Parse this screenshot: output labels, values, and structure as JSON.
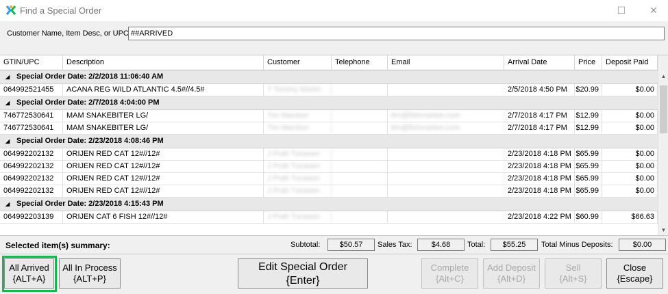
{
  "window": {
    "title": "Find a Special Order",
    "accent": "#1db44c"
  },
  "search": {
    "label": "Customer Name, Item Desc, or UPC:",
    "value": "##ARRIVED"
  },
  "columns": [
    "GTIN/UPC",
    "Description",
    "Customer",
    "Telephone",
    "Email",
    "Arrival Date",
    "Price",
    "Deposit Paid"
  ],
  "groups": [
    {
      "header": "Special Order Date: 2/2/2018 11:06:40 AM",
      "rows": [
        {
          "upc": "064992521455",
          "desc": "ACANA REG WILD ATLANTIC 4.5#//4.5#",
          "customer": "T Tommy Martin",
          "phone": "",
          "email": "",
          "arrival": "2/5/2018 4:50 PM",
          "price": "$20.99",
          "deposit": "$0.00"
        }
      ]
    },
    {
      "header": "Special Order Date: 2/7/2018 4:04:00 PM",
      "rows": [
        {
          "upc": "746772530641",
          "desc": "MAM SNAKEBITER LG/",
          "customer": "Tim Marston",
          "phone": "",
          "email": "tim@fishmarket.com",
          "arrival": "2/7/2018 4:17 PM",
          "price": "$12.99",
          "deposit": "$0.00"
        },
        {
          "upc": "746772530641",
          "desc": "MAM SNAKEBITER LG/",
          "customer": "Tim Marston",
          "phone": "",
          "email": "tim@fishmarket.com",
          "arrival": "2/7/2018 4:17 PM",
          "price": "$12.99",
          "deposit": "$0.00"
        }
      ]
    },
    {
      "header": "Special Order Date: 2/23/2018 4:08:46 PM",
      "rows": [
        {
          "upc": "064992202132",
          "desc": "ORIJEN RED CAT 12#//12#",
          "customer": "J Prah Tunasen",
          "phone": "",
          "email": "",
          "arrival": "2/23/2018 4:18 PM",
          "price": "$65.99",
          "deposit": "$0.00"
        },
        {
          "upc": "064992202132",
          "desc": "ORIJEN RED CAT 12#//12#",
          "customer": "J Prah Tunasen",
          "phone": "",
          "email": "",
          "arrival": "2/23/2018 4:18 PM",
          "price": "$65.99",
          "deposit": "$0.00"
        },
        {
          "upc": "064992202132",
          "desc": "ORIJEN RED CAT 12#//12#",
          "customer": "J Prah Tunasen",
          "phone": "",
          "email": "",
          "arrival": "2/23/2018 4:18 PM",
          "price": "$65.99",
          "deposit": "$0.00"
        },
        {
          "upc": "064992202132",
          "desc": "ORIJEN RED CAT 12#//12#",
          "customer": "J Prah Tunasen",
          "phone": "",
          "email": "",
          "arrival": "2/23/2018 4:18 PM",
          "price": "$65.99",
          "deposit": "$0.00"
        }
      ]
    },
    {
      "header": "Special Order Date: 2/23/2018 4:15:43 PM",
      "rows": [
        {
          "upc": "064992203139",
          "desc": "ORIJEN CAT 6 FISH 12#//12#",
          "customer": "J Prah Tunasen",
          "phone": "",
          "email": "",
          "arrival": "2/23/2018 4:22 PM",
          "price": "$60.99",
          "deposit": "$66.63"
        }
      ]
    }
  ],
  "summary": {
    "title": "Selected item(s) summary:",
    "subtotal_label": "Subtotal:",
    "subtotal": "$50.57",
    "tax_label": "Sales Tax:",
    "tax": "$4.68",
    "total_label": "Total:",
    "total": "$55.25",
    "minus_label": "Total Minus Deposits:",
    "minus": "$0.00"
  },
  "buttons": {
    "all_arrived": [
      "All Arrived",
      "{ALT+A}"
    ],
    "all_in_process": [
      "All In Process",
      "{ALT+P}"
    ],
    "edit": [
      "Edit Special Order",
      "{Enter}"
    ],
    "complete": [
      "Complete",
      "{Alt+C}"
    ],
    "add_deposit": [
      "Add Deposit",
      "{Alt+D}"
    ],
    "sell": [
      "Sell",
      "{Alt+S}"
    ],
    "close": [
      "Close",
      "{Escape}"
    ]
  }
}
